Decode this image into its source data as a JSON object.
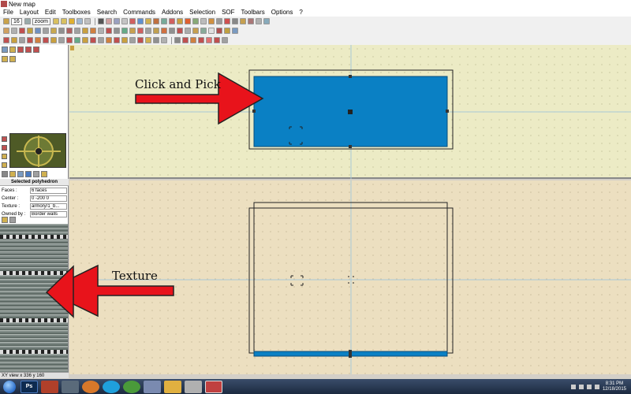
{
  "window": {
    "title": "New map"
  },
  "menu": [
    "File",
    "Layout",
    "Edit",
    "Toolboxes",
    "Search",
    "Commands",
    "Addons",
    "Selection",
    "SOF",
    "Toolbars",
    "Options",
    "?"
  ],
  "toolbar": {
    "grid_value": "16",
    "zoom_label": "zoom"
  },
  "properties": {
    "heading": "Selected polyhedron",
    "rows": [
      {
        "label": "Faces :",
        "value": "6 faces"
      },
      {
        "label": "Center :",
        "value": "0 -200 0"
      },
      {
        "label": "Texture :",
        "value": "armory/1_b..."
      },
      {
        "label": "Owned by :",
        "value": "Border walls"
      }
    ]
  },
  "status": {
    "view_text": "XY view x 336 y 160"
  },
  "annotations": {
    "pick_label": "Click and Pick",
    "texture_label": "Texture"
  },
  "taskbar": {
    "ps_label": "Ps",
    "time": "8:31 PM",
    "date": "12/18/2015"
  },
  "colors": {
    "selection": "#0a80c4",
    "arrow": "#e8131b",
    "top_view_bg": "#ecebc5",
    "bottom_view_bg": "#ecdfc0"
  }
}
